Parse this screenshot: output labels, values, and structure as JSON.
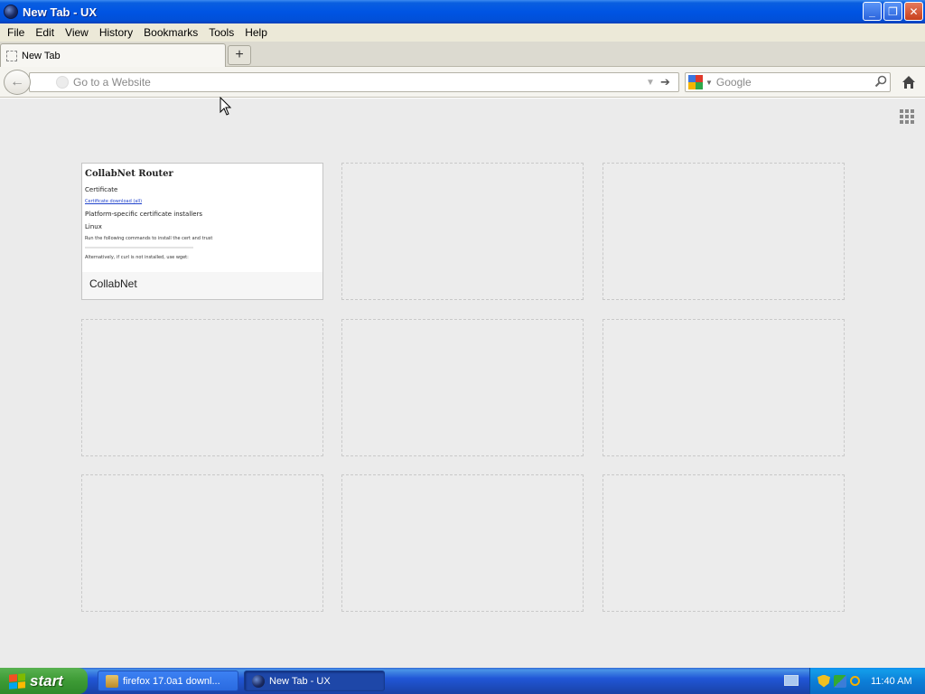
{
  "window": {
    "title": "New Tab - UX"
  },
  "menu": [
    "File",
    "Edit",
    "View",
    "History",
    "Bookmarks",
    "Tools",
    "Help"
  ],
  "tabs": [
    {
      "label": "New Tab"
    }
  ],
  "newtab_button": "+",
  "urlbar": {
    "placeholder": "Go to a Website",
    "value": ""
  },
  "search": {
    "placeholder": "Google",
    "engine": "Google"
  },
  "tiles": [
    {
      "title": "CollabNet",
      "thumbnail": {
        "heading": "CollabNet Router",
        "line1": "Certificate",
        "link": "Certificate download (all)",
        "line2": "Platform-specific certificate installers",
        "line3": "Linux",
        "line4": "Run the following commands to install the cert and trust",
        "line5": "Alternatively, if curl is not installed, use wget:"
      }
    }
  ],
  "taskbar": {
    "start_label": "start",
    "items": [
      {
        "label": "firefox 17.0a1 downl...",
        "active": false
      },
      {
        "label": "New Tab - UX",
        "active": true
      }
    ],
    "clock": "11:40 AM"
  },
  "colors": {
    "titlebar": "#0054e3",
    "menubar": "#ece9d8",
    "newtab_bg": "#ebebeb",
    "taskbar": "#2157d7",
    "start": "#3d9a35"
  }
}
